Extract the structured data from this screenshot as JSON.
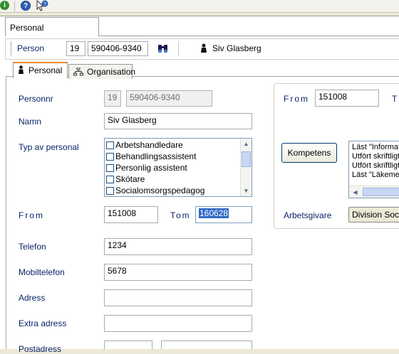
{
  "toolbar": {
    "icons": [
      "info-icon",
      "help-icon",
      "context-help-icon"
    ]
  },
  "doc_tab": {
    "label": "Personal"
  },
  "person_bar": {
    "label": "Person",
    "century": "19",
    "personnr": "590406-9340",
    "name": "Siv Glasberg"
  },
  "tabs": [
    {
      "label": "Personal",
      "icon": "person-icon",
      "active": true
    },
    {
      "label": "Organisation",
      "icon": "org-chart-icon",
      "active": false
    }
  ],
  "form": {
    "personnr_label": "Personnr",
    "personnr_century": "19",
    "personnr_value": "590406-9340",
    "namn_label": "Namn",
    "namn_value": "Siv Glasberg",
    "typ_label": "Typ av personal",
    "typ_options": [
      "Arbetshandledare",
      "Behandlingsassistent",
      "Personlig assistent",
      "Skötare",
      "Socialomsorgspedagog"
    ],
    "from_label": "From",
    "from_value": "151008",
    "tom_label": "Tom",
    "tom_value": "160628",
    "telefon_label": "Telefon",
    "telefon_value": "1234",
    "mobil_label": "Mobiltelefon",
    "mobil_value": "5678",
    "adress_label": "Adress",
    "adress_value": "",
    "extra_label": "Extra adress",
    "extra_value": "",
    "postadress_label": "Postadress"
  },
  "right": {
    "from_label": "From",
    "from_value": "151008",
    "tom_label_partial": "T",
    "kompetens_button": "Kompetens",
    "kompetens_items": [
      "Läst \"Informat",
      "Utfört skriftligt",
      "Utfört skriftligt",
      "Läst \"Läkeme"
    ],
    "arbetsgivare_label": "Arbetsgivare",
    "arbetsgivare_value": "Division Socia"
  },
  "colors": {
    "label": "#0a246a",
    "active_tab_accent": "#e68b2c",
    "selection": "#316ac5"
  }
}
